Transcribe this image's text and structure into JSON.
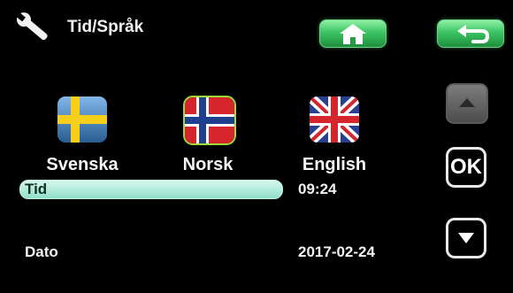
{
  "header": {
    "title": "Tid/Språk"
  },
  "languages": [
    {
      "label": "Svenska"
    },
    {
      "label": "Norsk"
    },
    {
      "label": "English"
    }
  ],
  "settings": {
    "tid_label": "Tid",
    "tid_value": "09:24",
    "dato_label": "Dato",
    "dato_value": "2017-02-24"
  },
  "side_buttons": {
    "ok_label": "OK"
  },
  "colors": {
    "accent_green": "#3cc463",
    "selection_bar": "#8fe0c8",
    "background": "#000000"
  },
  "icons": [
    "wrench-icon",
    "home-icon",
    "back-arrow-icon",
    "sweden-flag-icon",
    "norway-flag-icon",
    "uk-flag-icon",
    "arrow-up-icon",
    "arrow-down-icon"
  ]
}
